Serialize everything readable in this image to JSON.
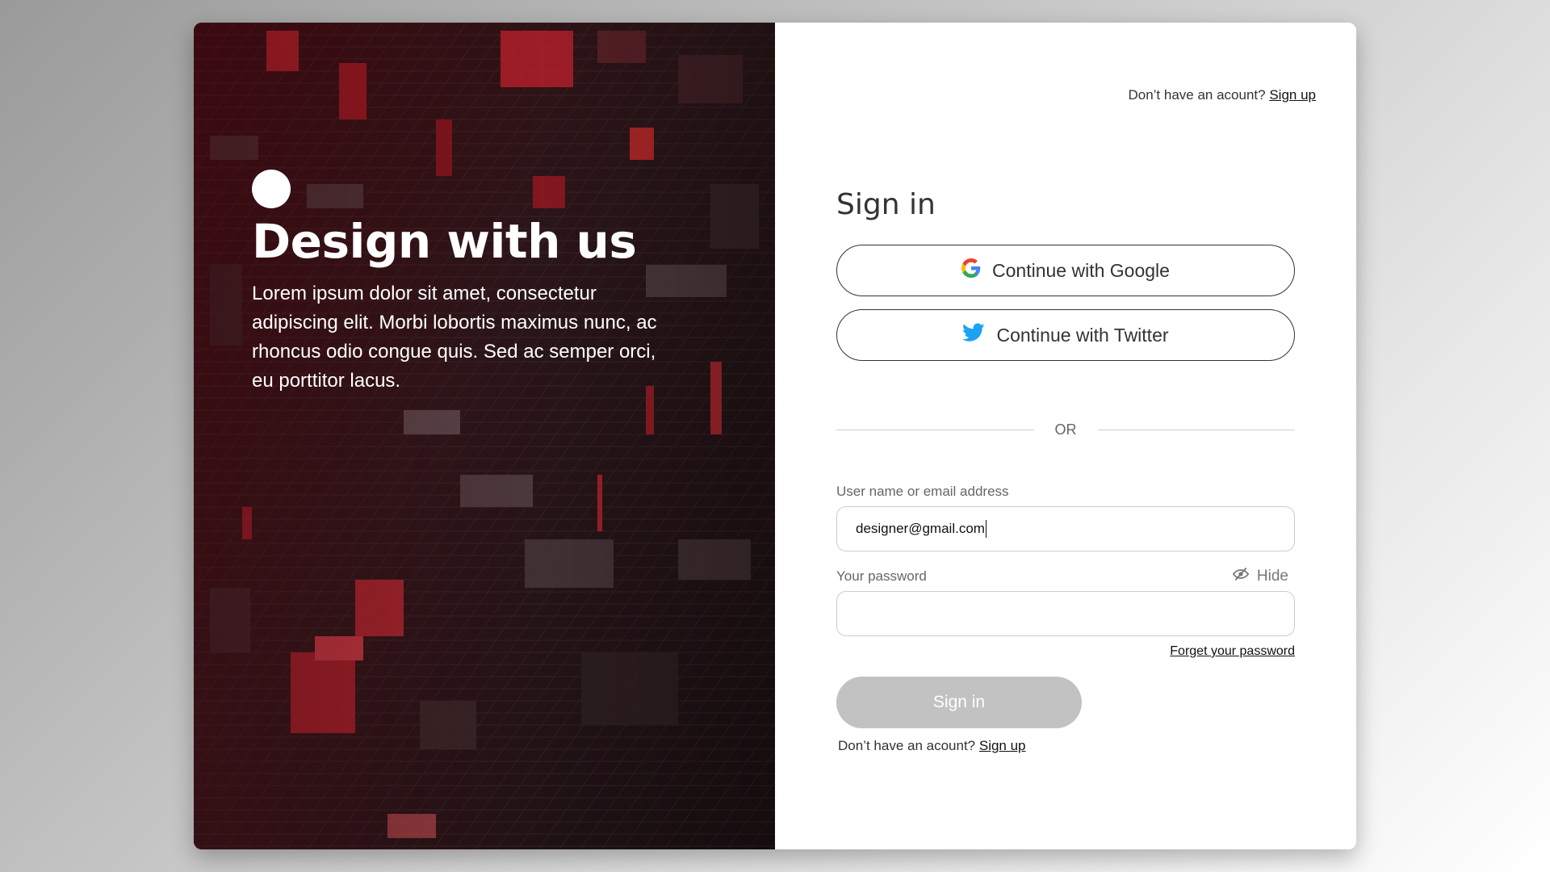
{
  "hero": {
    "title": "Design with us",
    "text": "Lorem ipsum dolor sit amet, consectetur adipiscing elit. Morbi lobortis maximus nunc, ac rhoncus odio congue quis. Sed ac semper orci, eu porttitor lacus."
  },
  "header": {
    "prompt": "Don’t have an acount?",
    "signup_link": "Sign up"
  },
  "form": {
    "title": "Sign in",
    "google_label": "Continue with Google",
    "twitter_label": "Continue with Twitter",
    "or_text": "OR",
    "username_label": "User name or email address",
    "username_value": "designer@gmail.com",
    "password_label": "Your password",
    "password_value": "",
    "hide_label": "Hide",
    "forget_link": "Forget your password",
    "submit_label": "Sign in",
    "footer_prompt": "Don’t have an acount?",
    "footer_signup_link": "Sign up"
  },
  "icons": {
    "google": "google-icon",
    "twitter": "twitter-icon",
    "hide": "eye-slash-icon"
  },
  "colors": {
    "twitter_blue": "#1DA1F2",
    "submit_disabled": "#C2C2C2",
    "accent_red": "#D8232F"
  }
}
